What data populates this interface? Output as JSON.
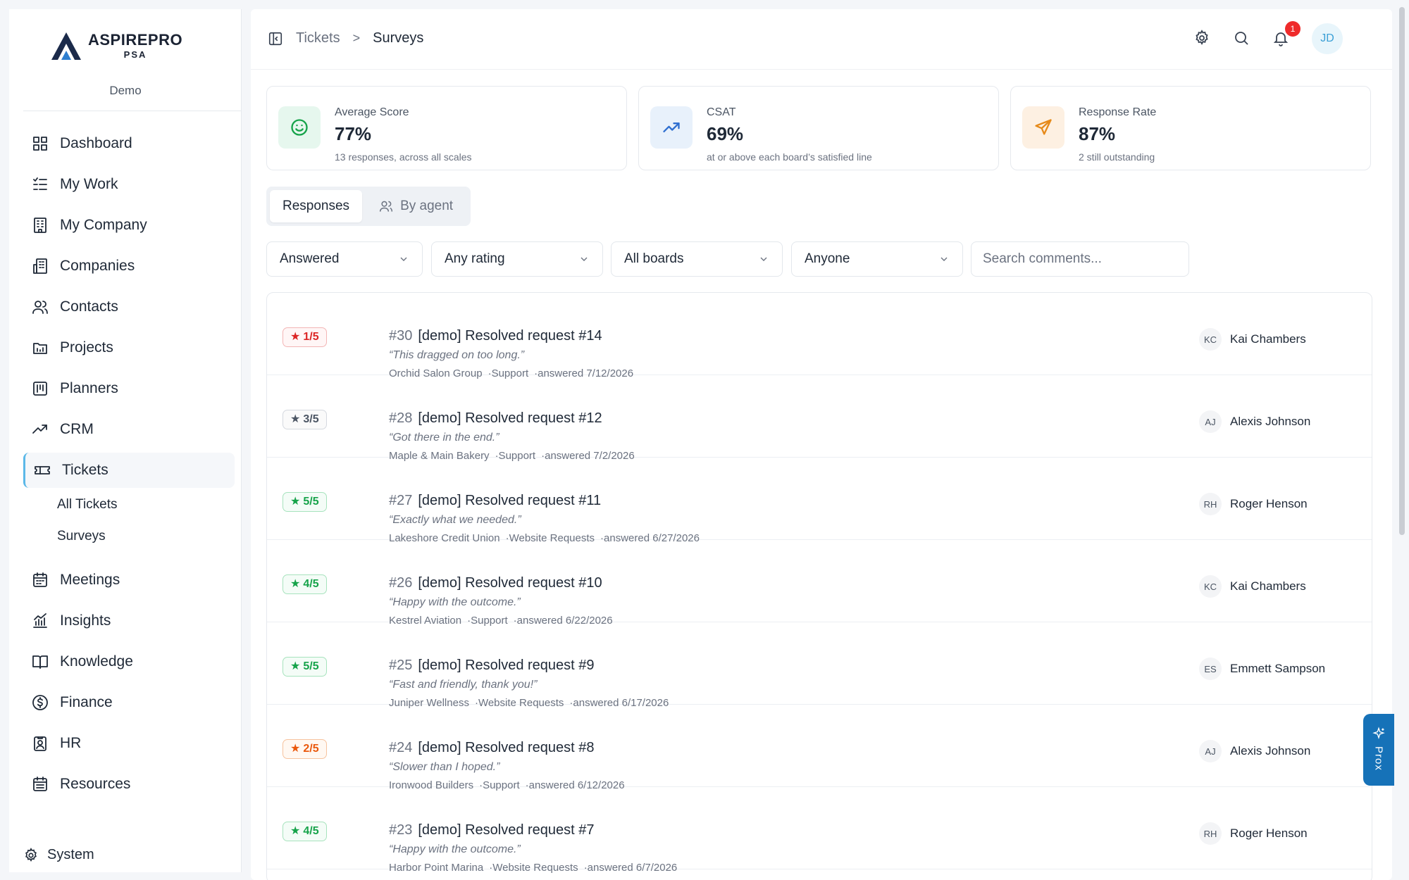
{
  "brand": {
    "name": "ASPIREPRO",
    "sub": "PSA",
    "org": "Demo"
  },
  "nav": [
    {
      "label": "Dashboard",
      "icon": "dashboard-icon"
    },
    {
      "label": "My Work",
      "icon": "list-check-icon"
    },
    {
      "label": "My Company",
      "icon": "building-icon"
    },
    {
      "label": "Companies",
      "icon": "buildings-icon"
    },
    {
      "label": "Contacts",
      "icon": "users-icon"
    },
    {
      "label": "Projects",
      "icon": "folder-icon"
    },
    {
      "label": "Planners",
      "icon": "kanban-icon"
    },
    {
      "label": "CRM",
      "icon": "trend-icon"
    },
    {
      "label": "Tickets",
      "icon": "ticket-icon"
    },
    {
      "label": "Meetings",
      "icon": "calendar-icon"
    },
    {
      "label": "Insights",
      "icon": "chart-icon"
    },
    {
      "label": "Knowledge",
      "icon": "book-icon"
    },
    {
      "label": "Finance",
      "icon": "dollar-icon"
    },
    {
      "label": "HR",
      "icon": "badge-icon"
    },
    {
      "label": "Resources",
      "icon": "calendar-grid-icon"
    }
  ],
  "tickets_sub": [
    "All Tickets",
    "Surveys"
  ],
  "system_label": "System",
  "breadcrumb": {
    "parent": "Tickets",
    "separator": ">",
    "current": "Surveys"
  },
  "header": {
    "notifications": "1",
    "avatar": "JD"
  },
  "stats": [
    {
      "label": "Average Score",
      "value": "77%",
      "sub": "13 responses, across all scales",
      "icon": "smile-icon",
      "bg": "#e6f7ee",
      "color": "#16a34a"
    },
    {
      "label": "CSAT",
      "value": "69%",
      "sub": "at or above each board’s satisfied line",
      "icon": "trending-up-icon",
      "bg": "#e8f1fb",
      "color": "#2f6fd0"
    },
    {
      "label": "Response Rate",
      "value": "87%",
      "sub": "2 still outstanding",
      "icon": "send-icon",
      "bg": "#fdf0e2",
      "color": "#e68a1a"
    }
  ],
  "tabs": [
    "Responses",
    "By agent"
  ],
  "filters": [
    "Answered",
    "Any rating",
    "All boards",
    "Anyone"
  ],
  "search_placeholder": "Search comments...",
  "responses": [
    {
      "rating": "1/5",
      "tone": "red",
      "num": "#30",
      "title": "[demo] Resolved request #14",
      "comment": "“This dragged on too long.”",
      "company": "Orchid Salon Group",
      "board": "·Support",
      "answered": "·answered 7/12/2026",
      "agent_initials": "KC",
      "agent": "Kai Chambers"
    },
    {
      "rating": "3/5",
      "tone": "gray",
      "num": "#28",
      "title": "[demo] Resolved request #12",
      "comment": "“Got there in the end.”",
      "company": "Maple & Main Bakery",
      "board": "·Support",
      "answered": "·answered 7/2/2026",
      "agent_initials": "AJ",
      "agent": "Alexis Johnson"
    },
    {
      "rating": "5/5",
      "tone": "green",
      "num": "#27",
      "title": "[demo] Resolved request #11",
      "comment": "“Exactly what we needed.”",
      "company": "Lakeshore Credit Union",
      "board": "·Website Requests",
      "answered": "·answered 6/27/2026",
      "agent_initials": "RH",
      "agent": "Roger Henson"
    },
    {
      "rating": "4/5",
      "tone": "green",
      "num": "#26",
      "title": "[demo] Resolved request #10",
      "comment": "“Happy with the outcome.”",
      "company": "Kestrel Aviation",
      "board": "·Support",
      "answered": "·answered 6/22/2026",
      "agent_initials": "KC",
      "agent": "Kai Chambers"
    },
    {
      "rating": "5/5",
      "tone": "green",
      "num": "#25",
      "title": "[demo] Resolved request #9",
      "comment": "“Fast and friendly, thank you!”",
      "company": "Juniper Wellness",
      "board": "·Website Requests",
      "answered": "·answered 6/17/2026",
      "agent_initials": "ES",
      "agent": "Emmett Sampson"
    },
    {
      "rating": "2/5",
      "tone": "orange",
      "num": "#24",
      "title": "[demo] Resolved request #8",
      "comment": "“Slower than I hoped.”",
      "company": "Ironwood Builders",
      "board": "·Support",
      "answered": "·answered 6/12/2026",
      "agent_initials": "AJ",
      "agent": "Alexis Johnson"
    },
    {
      "rating": "4/5",
      "tone": "green",
      "num": "#23",
      "title": "[demo] Resolved request #7",
      "comment": "“Happy with the outcome.”",
      "company": "Harbor Point Marina",
      "board": "·Website Requests",
      "answered": "·answered 6/7/2026",
      "agent_initials": "RH",
      "agent": "Roger Henson"
    }
  ],
  "assistant_label": "Prox"
}
